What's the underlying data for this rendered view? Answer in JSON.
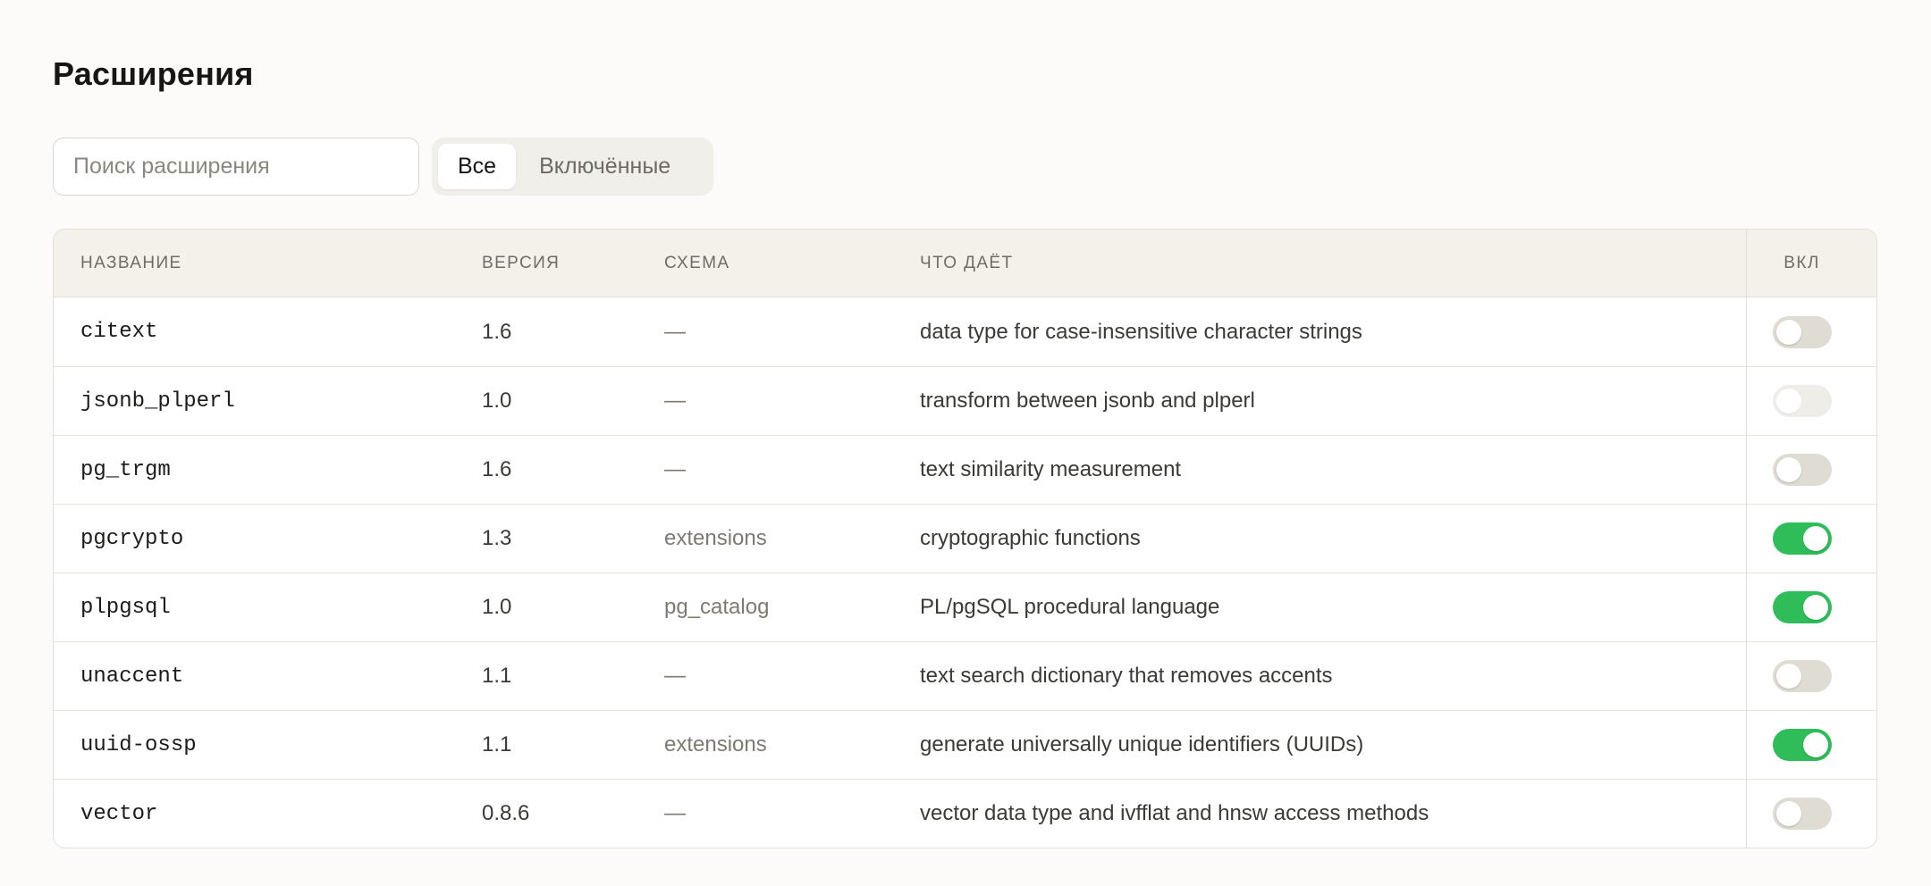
{
  "page": {
    "title": "Расширения"
  },
  "search": {
    "placeholder": "Поиск расширения",
    "value": ""
  },
  "filter": {
    "options": [
      {
        "label": "Все",
        "selected": true
      },
      {
        "label": "Включённые",
        "selected": false
      }
    ]
  },
  "table": {
    "columns": {
      "name": "НАЗВАНИЕ",
      "version": "ВЕРСИЯ",
      "schema": "СХЕМА",
      "description": "ЧТО ДАЁТ",
      "enabled": "ВКЛ"
    },
    "rows": [
      {
        "name": "citext",
        "version": "1.6",
        "schema": "—",
        "description": "data type for case-insensitive character strings",
        "enabled": false,
        "disabled": false
      },
      {
        "name": "jsonb_plperl",
        "version": "1.0",
        "schema": "—",
        "description": "transform between jsonb and plperl",
        "enabled": false,
        "disabled": true
      },
      {
        "name": "pg_trgm",
        "version": "1.6",
        "schema": "—",
        "description": "text similarity measurement",
        "enabled": false,
        "disabled": false
      },
      {
        "name": "pgcrypto",
        "version": "1.3",
        "schema": "extensions",
        "description": "cryptographic functions",
        "enabled": true,
        "disabled": false
      },
      {
        "name": "plpgsql",
        "version": "1.0",
        "schema": "pg_catalog",
        "description": "PL/pgSQL procedural language",
        "enabled": true,
        "disabled": false
      },
      {
        "name": "unaccent",
        "version": "1.1",
        "schema": "—",
        "description": "text search dictionary that removes accents",
        "enabled": false,
        "disabled": false
      },
      {
        "name": "uuid-ossp",
        "version": "1.1",
        "schema": "extensions",
        "description": "generate universally unique identifiers (UUIDs)",
        "enabled": true,
        "disabled": false
      },
      {
        "name": "vector",
        "version": "0.8.6",
        "schema": "—",
        "description": "vector data type and ivfflat and hnsw access methods",
        "enabled": false,
        "disabled": false
      }
    ]
  },
  "colors": {
    "accent_on": "#2fbd5a",
    "toggle_off": "#dfdcd4",
    "toggle_disabled": "#efede8",
    "background": "#fcfbf9",
    "header_bg": "#f4f1eb"
  }
}
